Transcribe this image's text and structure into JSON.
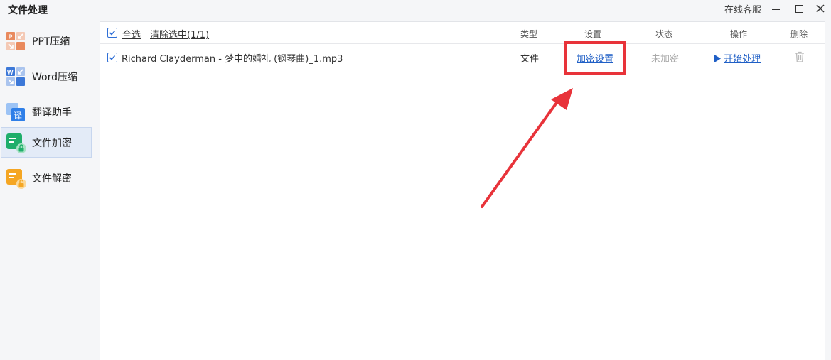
{
  "window": {
    "title": "文件处理",
    "online_service": "在线客服"
  },
  "sidebar": {
    "items": [
      {
        "label": "PPT压缩",
        "icon": "ppt-compress-icon",
        "active": false
      },
      {
        "label": "Word压缩",
        "icon": "word-compress-icon",
        "active": false
      },
      {
        "label": "翻译助手",
        "icon": "translate-icon",
        "active": false
      },
      {
        "label": "文件加密",
        "icon": "file-encrypt-icon",
        "active": true
      },
      {
        "label": "文件解密",
        "icon": "file-decrypt-icon",
        "active": false
      }
    ]
  },
  "toolbar": {
    "select_all": "全选",
    "clear_selection": "清除选中(1/1)"
  },
  "table": {
    "columns": {
      "type": "类型",
      "settings": "设置",
      "status": "状态",
      "action": "操作",
      "delete": "删除"
    },
    "rows": [
      {
        "checked": true,
        "filename": "Richard Clayderman - 梦中的婚礼 (钢琴曲)_1.mp3",
        "type": "文件",
        "settings_link": "加密设置",
        "status": "未加密",
        "action_link": "开始处理"
      }
    ]
  },
  "colors": {
    "accent": "#1f5fc6",
    "annotation_red": "#e8333a",
    "active_bg": "#e3ebf7"
  }
}
